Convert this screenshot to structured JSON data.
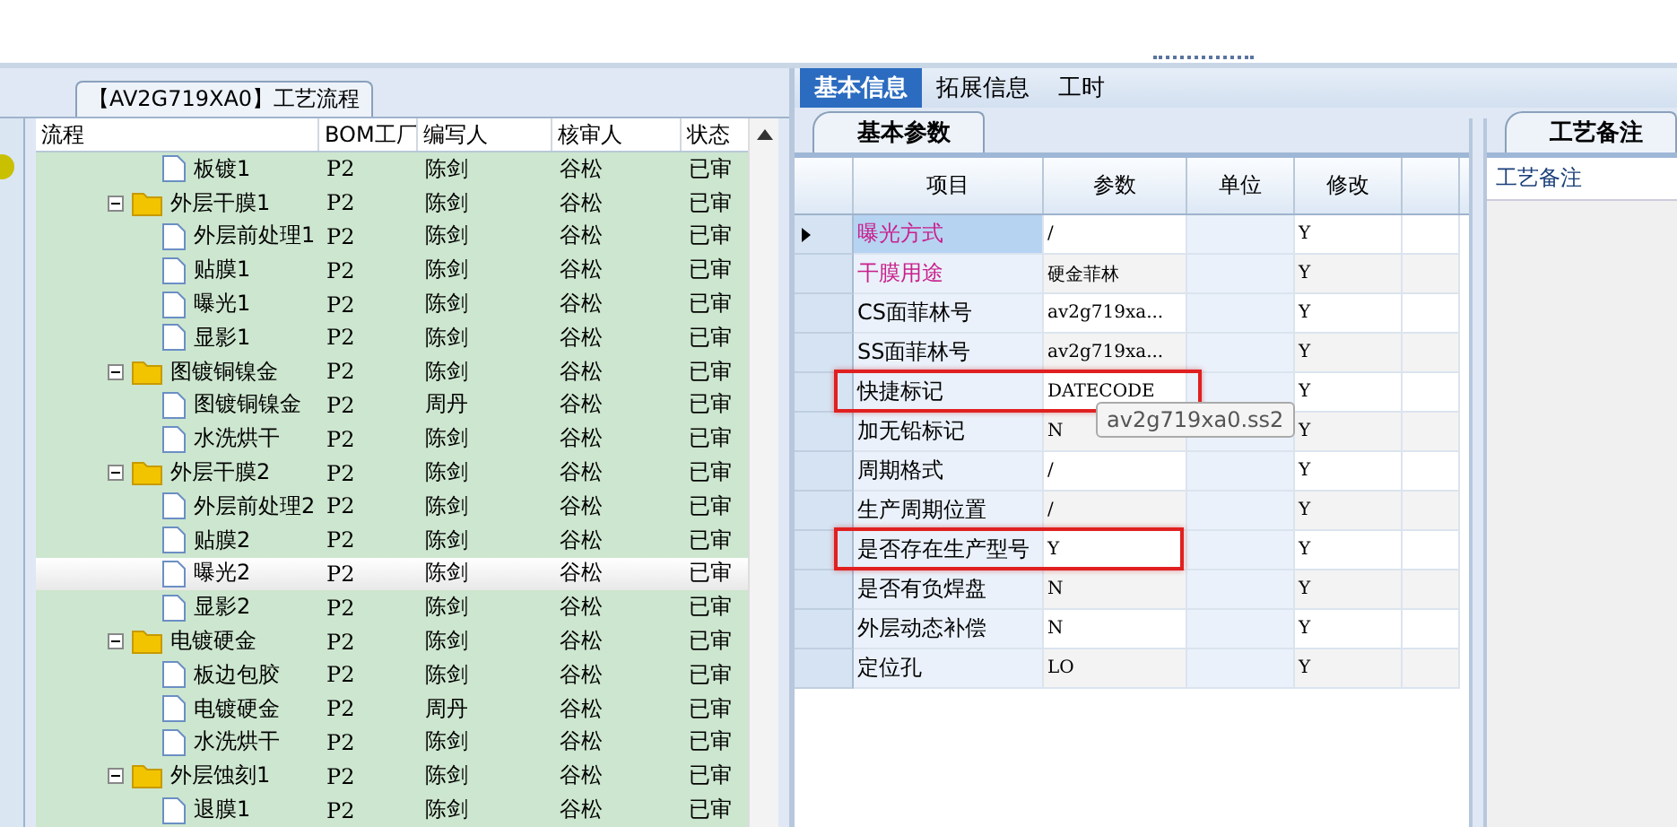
{
  "process_panel": {
    "title": "【AV2G719XA0】工艺流程",
    "columns": [
      "流程",
      "BOM工厂",
      "编写人",
      "核审人",
      "状态"
    ],
    "tree": [
      {
        "kind": "file",
        "name": "板镀1",
        "factory": "P2",
        "author": "陈剑",
        "reviewer": "谷松",
        "status": "已审",
        "selected": false
      },
      {
        "kind": "folder",
        "name": "外层干膜1",
        "factory": "P2",
        "author": "陈剑",
        "reviewer": "谷松",
        "status": "已审",
        "selected": false,
        "expanded": true,
        "children": [
          {
            "kind": "file",
            "name": "外层前处理1",
            "factory": "P2",
            "author": "陈剑",
            "reviewer": "谷松",
            "status": "已审",
            "selected": false
          },
          {
            "kind": "file",
            "name": "贴膜1",
            "factory": "P2",
            "author": "陈剑",
            "reviewer": "谷松",
            "status": "已审",
            "selected": false
          },
          {
            "kind": "file",
            "name": "曝光1",
            "factory": "P2",
            "author": "陈剑",
            "reviewer": "谷松",
            "status": "已审",
            "selected": false
          },
          {
            "kind": "file",
            "name": "显影1",
            "factory": "P2",
            "author": "陈剑",
            "reviewer": "谷松",
            "status": "已审",
            "selected": false
          }
        ]
      },
      {
        "kind": "folder",
        "name": "图镀铜镍金",
        "factory": "P2",
        "author": "陈剑",
        "reviewer": "谷松",
        "status": "已审",
        "selected": false,
        "expanded": true,
        "children": [
          {
            "kind": "file",
            "name": "图镀铜镍金",
            "factory": "P2",
            "author": "周丹",
            "reviewer": "谷松",
            "status": "已审",
            "selected": false
          },
          {
            "kind": "file",
            "name": "水洗烘干",
            "factory": "P2",
            "author": "陈剑",
            "reviewer": "谷松",
            "status": "已审",
            "selected": false
          }
        ]
      },
      {
        "kind": "folder",
        "name": "外层干膜2",
        "factory": "P2",
        "author": "陈剑",
        "reviewer": "谷松",
        "status": "已审",
        "selected": false,
        "expanded": true,
        "children": [
          {
            "kind": "file",
            "name": "外层前处理2",
            "factory": "P2",
            "author": "陈剑",
            "reviewer": "谷松",
            "status": "已审",
            "selected": false
          },
          {
            "kind": "file",
            "name": "贴膜2",
            "factory": "P2",
            "author": "陈剑",
            "reviewer": "谷松",
            "status": "已审",
            "selected": false
          },
          {
            "kind": "file",
            "name": "曝光2",
            "factory": "P2",
            "author": "陈剑",
            "reviewer": "谷松",
            "status": "已审",
            "selected": true
          },
          {
            "kind": "file",
            "name": "显影2",
            "factory": "P2",
            "author": "陈剑",
            "reviewer": "谷松",
            "status": "已审",
            "selected": false
          }
        ]
      },
      {
        "kind": "folder",
        "name": "电镀硬金",
        "factory": "P2",
        "author": "陈剑",
        "reviewer": "谷松",
        "status": "已审",
        "selected": false,
        "expanded": true,
        "children": [
          {
            "kind": "file",
            "name": "板边包胶",
            "factory": "P2",
            "author": "陈剑",
            "reviewer": "谷松",
            "status": "已审",
            "selected": false
          },
          {
            "kind": "file",
            "name": "电镀硬金",
            "factory": "P2",
            "author": "周丹",
            "reviewer": "谷松",
            "status": "已审",
            "selected": false
          },
          {
            "kind": "file",
            "name": "水洗烘干",
            "factory": "P2",
            "author": "陈剑",
            "reviewer": "谷松",
            "status": "已审",
            "selected": false
          }
        ]
      },
      {
        "kind": "folder",
        "name": "外层蚀刻1",
        "factory": "P2",
        "author": "陈剑",
        "reviewer": "谷松",
        "status": "已审",
        "selected": false,
        "expanded": true,
        "children": [
          {
            "kind": "file",
            "name": "退膜1",
            "factory": "P2",
            "author": "陈剑",
            "reviewer": "谷松",
            "status": "已审",
            "selected": false
          }
        ]
      }
    ]
  },
  "tabs": [
    {
      "label": "基本信息",
      "selected": true
    },
    {
      "label": "拓展信息",
      "selected": false
    },
    {
      "label": "工时",
      "selected": false
    }
  ],
  "params_panel": {
    "tab": "基本参数",
    "columns": [
      "项目",
      "参数",
      "单位",
      "修改"
    ],
    "rows": [
      {
        "item": "曝光方式",
        "color": "#c8208c",
        "value": "/",
        "modified": "Y",
        "selected": true,
        "highlighted": false
      },
      {
        "item": "干膜用途",
        "color": "#c8208c",
        "value": "硬金菲林",
        "modified": "Y",
        "selected": false,
        "highlighted": false
      },
      {
        "item": "CS面菲林号",
        "color": "#000000",
        "value": "av2g719xa...",
        "modified": "Y",
        "selected": false,
        "highlighted": false
      },
      {
        "item": "SS面菲林号",
        "color": "#000000",
        "value": "av2g719xa...",
        "modified": "Y",
        "selected": false,
        "highlighted": false
      },
      {
        "item": "快捷标记",
        "color": "#000000",
        "value": "DATECODE",
        "modified": "Y",
        "selected": false,
        "highlighted": true
      },
      {
        "item": "加无铅标记",
        "color": "#000000",
        "value": "N",
        "modified": "Y",
        "selected": false,
        "highlighted": false
      },
      {
        "item": "周期格式",
        "color": "#000000",
        "value": "/",
        "modified": "Y",
        "selected": false,
        "highlighted": false
      },
      {
        "item": "生产周期位置",
        "color": "#000000",
        "value": "/",
        "modified": "Y",
        "selected": false,
        "highlighted": false
      },
      {
        "item": "是否存在生产型号",
        "color": "#000000",
        "value": "Y",
        "modified": "Y",
        "selected": false,
        "highlighted": true
      },
      {
        "item": "是否有负焊盘",
        "color": "#000000",
        "value": "N",
        "modified": "Y",
        "selected": false,
        "highlighted": false
      },
      {
        "item": "外层动态补偿",
        "color": "#000000",
        "value": "N",
        "modified": "Y",
        "selected": false,
        "highlighted": false
      },
      {
        "item": "定位孔",
        "color": "#000000",
        "value": "LO",
        "modified": "Y",
        "selected": false,
        "highlighted": false
      }
    ],
    "tooltip": "av2g719xa0.ss2"
  },
  "notes_panel": {
    "tab": "工艺备注",
    "label": "工艺备注"
  }
}
